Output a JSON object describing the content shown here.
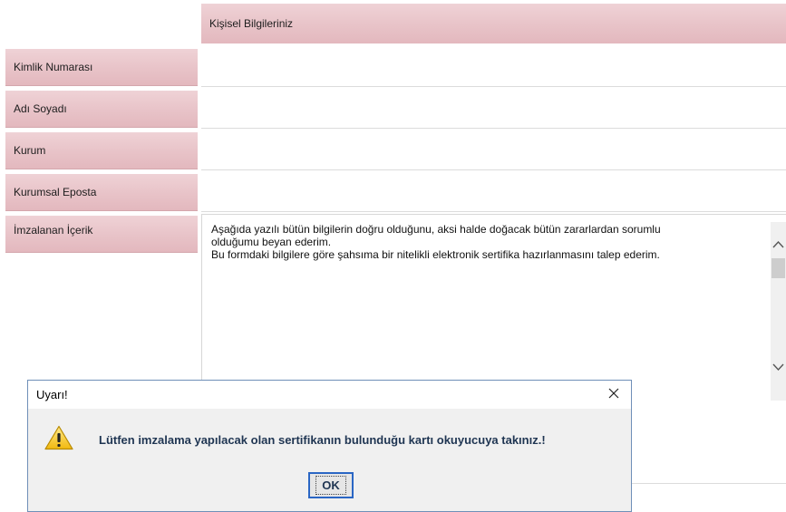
{
  "form": {
    "header_title": "Kişisel Bilgileriniz",
    "fields": [
      {
        "label": "Kimlik Numarası"
      },
      {
        "label": "Adı Soyadı"
      },
      {
        "label": "Kurum"
      },
      {
        "label": "Kurumsal Eposta"
      },
      {
        "label": "İmzalanan İçerik"
      }
    ],
    "signed_content": "Aşağıda yazılı bütün bilgilerin doğru olduğunu, aksi halde doğacak bütün zararlardan sorumlu\nolduğumu beyan ederim.\nBu formdaki bilgilere göre şahsıma bir nitelikli elektronik sertifika hazırlanmasını talep ederim."
  },
  "dialog": {
    "title": "Uyarı!",
    "message": "Lütfen imzalama yapılacak olan sertifikanın bulunduğu kartı okuyucuya takınız.!",
    "ok_label": "OK",
    "icon": "warning-icon",
    "close_icon": "close-icon"
  },
  "colors": {
    "label_bg": "#e8c3c8",
    "dialog_text": "#1f3552",
    "focus_border": "#2a66c4"
  }
}
